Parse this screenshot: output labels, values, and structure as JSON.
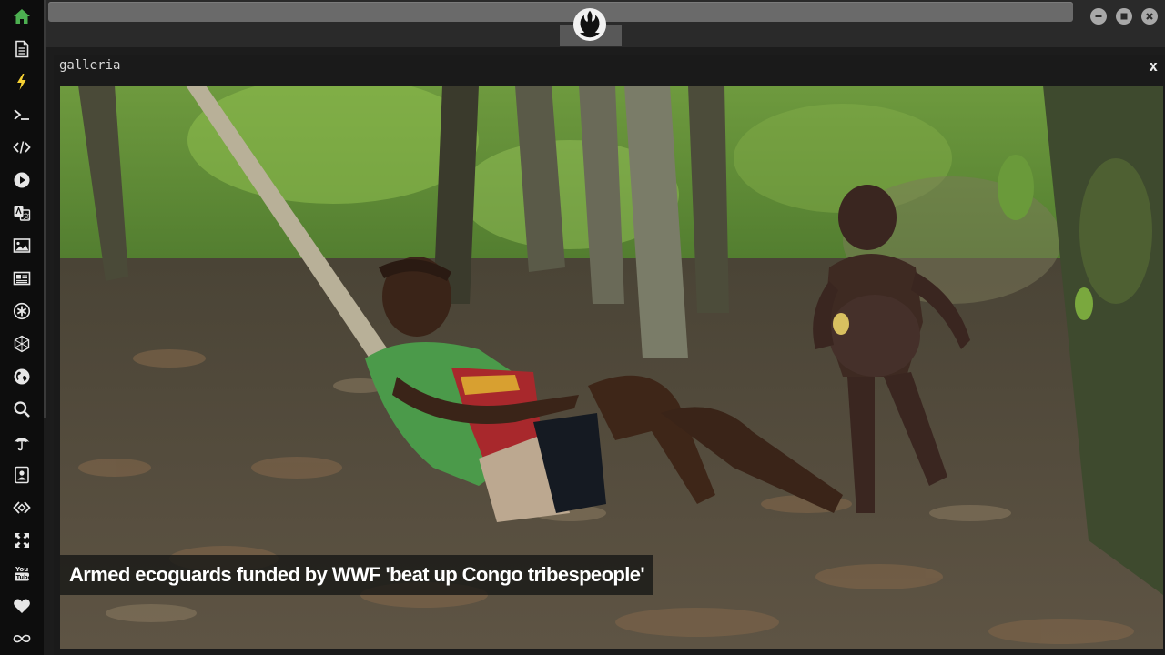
{
  "sidebar": {
    "active_color": "#4caf50",
    "icon_color": "#e6e6e6",
    "items": [
      {
        "icon": "home-icon",
        "active": true
      },
      {
        "icon": "document-icon"
      },
      {
        "icon": "lightning-icon"
      },
      {
        "icon": "terminal-icon"
      },
      {
        "icon": "code-icon"
      },
      {
        "icon": "play-icon"
      },
      {
        "icon": "translate-icon"
      },
      {
        "icon": "image-icon"
      },
      {
        "icon": "newspaper-icon"
      },
      {
        "icon": "asterisk-icon"
      },
      {
        "icon": "hexagon-icon"
      },
      {
        "icon": "globe-icon"
      },
      {
        "icon": "search-icon"
      },
      {
        "icon": "umbrella-icon"
      },
      {
        "icon": "contact-card-icon"
      },
      {
        "icon": "diamond-code-icon"
      },
      {
        "icon": "expand-arrows-icon"
      },
      {
        "icon": "youtube-icon"
      },
      {
        "icon": "heart-icon"
      },
      {
        "icon": "infinity-cloud-icon"
      }
    ]
  },
  "topbar": {
    "logo_icon": "rebel-alliance-icon",
    "window_controls": [
      "minimize-icon",
      "maximize-icon",
      "close-icon"
    ]
  },
  "panel": {
    "title": "galleria",
    "close_label": "x",
    "caption": "Armed ecoguards funded by WWF 'beat up Congo tribespeople'"
  }
}
